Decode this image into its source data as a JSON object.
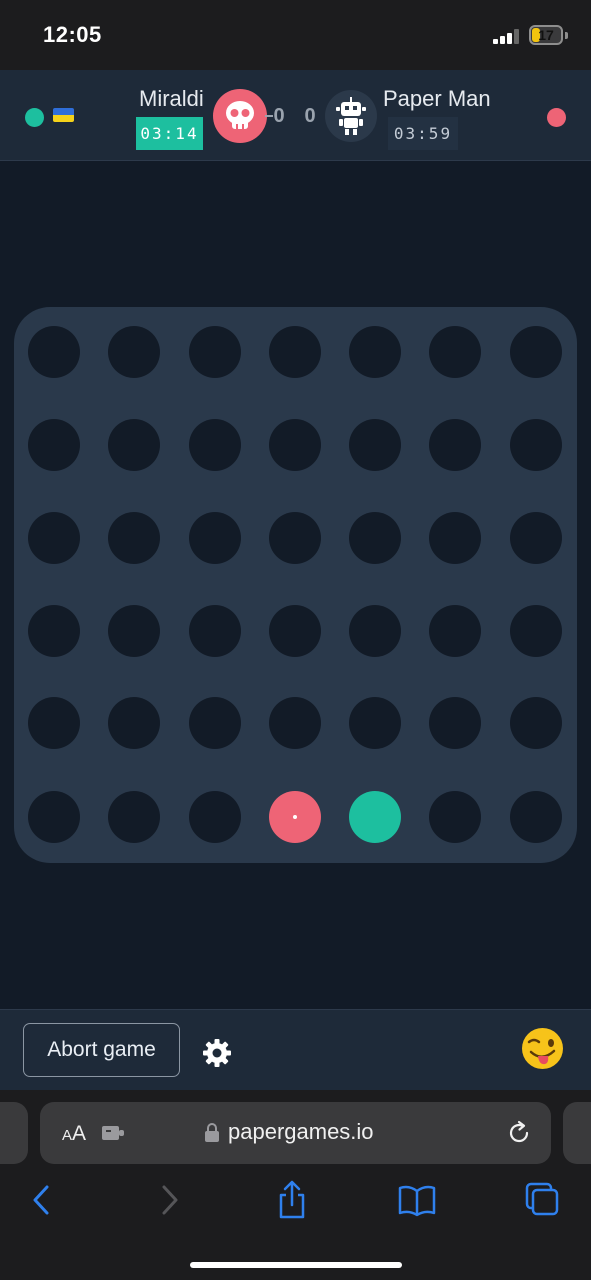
{
  "status_bar": {
    "time": "12:05",
    "battery": "17"
  },
  "match": {
    "player1": {
      "name": "Miraldi",
      "timer": "03:14",
      "score": "0",
      "avatar_icon": "skull-icon",
      "flag_icon": "ukraine-flag-icon",
      "online_status": "online",
      "color": "#1dbf9f"
    },
    "player2": {
      "name": "Paper Man",
      "timer": "03:59",
      "score": "0",
      "avatar_icon": "robot-icon",
      "online_status": "online",
      "color": "#ee6476"
    }
  },
  "board": {
    "rows": 6,
    "columns": 7,
    "grid": [
      [
        "",
        "",
        "",
        "",
        "",
        "",
        ""
      ],
      [
        "",
        "",
        "",
        "",
        "",
        "",
        ""
      ],
      [
        "",
        "",
        "",
        "",
        "",
        "",
        ""
      ],
      [
        "",
        "",
        "",
        "",
        "",
        "",
        ""
      ],
      [
        "",
        "",
        "",
        "",
        "",
        "",
        ""
      ],
      [
        "",
        "",
        "",
        "red",
        "teal",
        "",
        ""
      ]
    ],
    "last_move_marker": "red"
  },
  "footer": {
    "abort_label": "Abort game",
    "settings_icon": "gear-icon",
    "emoji_icon": "winking-tongue-emoji-icon"
  },
  "browser": {
    "reader_label": "AA",
    "url": "papergames.io"
  },
  "colors": {
    "background": "#121b27",
    "panel": "#1e2a39",
    "board": "#2a394b",
    "red_disc": "#ee6476",
    "teal_disc": "#1dbf9f",
    "ios_blue": "#2f80ed"
  }
}
